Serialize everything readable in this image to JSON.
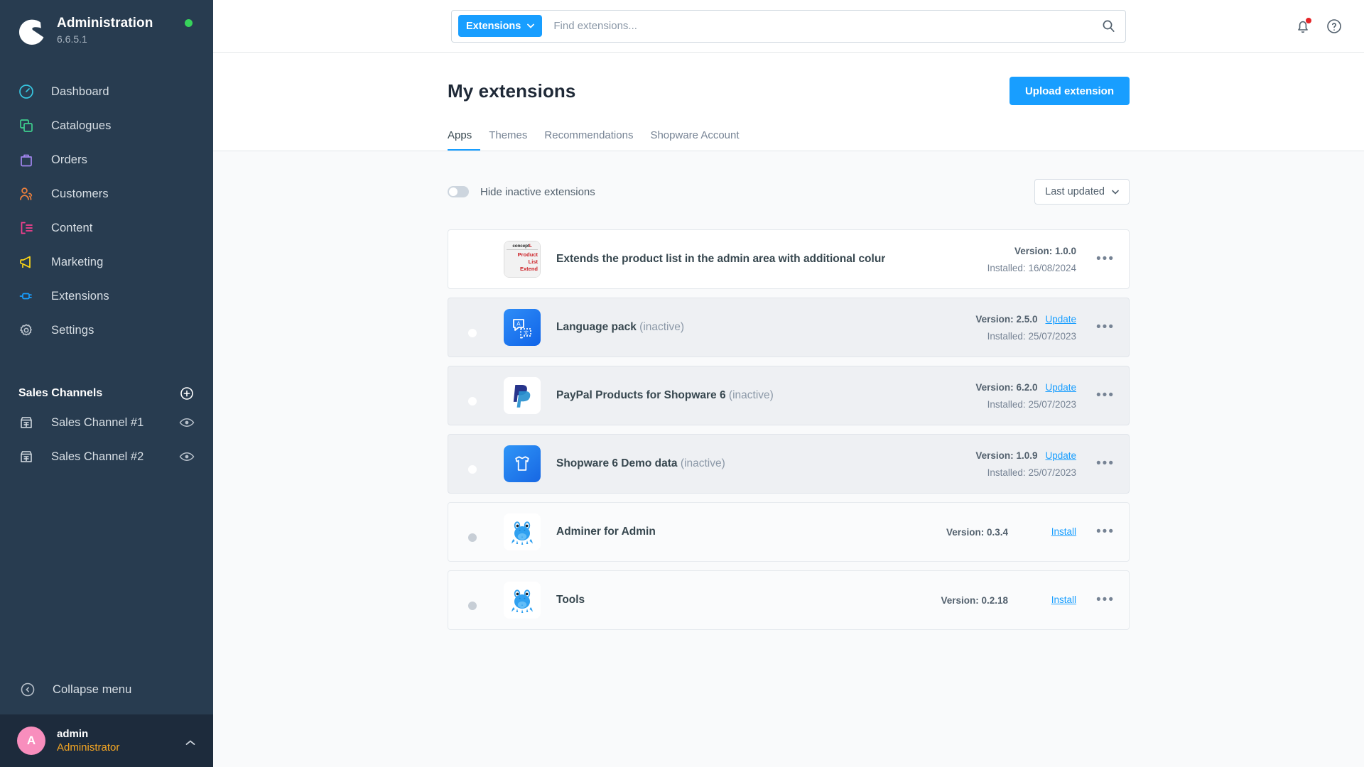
{
  "sidebar": {
    "title": "Administration",
    "version": "6.6.5.1",
    "status_color": "#37d35b",
    "nav": [
      {
        "label": "Dashboard",
        "icon": "gauge-icon",
        "color": "#37c6e0"
      },
      {
        "label": "Catalogues",
        "icon": "copy-icon",
        "color": "#3ecf8e"
      },
      {
        "label": "Orders",
        "icon": "bag-icon",
        "color": "#a386f0"
      },
      {
        "label": "Customers",
        "icon": "users-icon",
        "color": "#f0813c"
      },
      {
        "label": "Content",
        "icon": "content-icon",
        "color": "#f53f8e"
      },
      {
        "label": "Marketing",
        "icon": "megaphone-icon",
        "color": "#ffd814"
      },
      {
        "label": "Extensions",
        "icon": "plug-icon",
        "color": "#189eff"
      },
      {
        "label": "Settings",
        "icon": "gear-icon",
        "color": "#b6bfc9"
      }
    ],
    "section_title": "Sales Channels",
    "channels": [
      {
        "label": "Sales Channel #1"
      },
      {
        "label": "Sales Channel #2"
      }
    ],
    "collapse_label": "Collapse menu",
    "user": {
      "initial": "A",
      "name": "admin",
      "role": "Administrator",
      "role_color": "#f5a623"
    }
  },
  "topbar": {
    "scope_label": "Extensions",
    "search_placeholder": "Find extensions...",
    "notifications_badge": true
  },
  "page": {
    "title": "My extensions",
    "upload_label": "Upload extension",
    "tabs": [
      {
        "label": "Apps",
        "active": true
      },
      {
        "label": "Themes",
        "active": false
      },
      {
        "label": "Recommendations",
        "active": false
      },
      {
        "label": "Shopware Account",
        "active": false
      }
    ],
    "hide_inactive_label": "Hide inactive extensions",
    "hide_inactive_on": false,
    "sort_label": "Last updated",
    "version_prefix": "Version:",
    "installed_prefix": "Installed:"
  },
  "extensions": [
    {
      "name": "Extends the product list in the admin area with additional colur",
      "status_suffix": "",
      "state": "active",
      "enabled": true,
      "version": "1.0.0",
      "installed": "16/08/2024",
      "action": "",
      "logo": "concept-product-list-extend-logo"
    },
    {
      "name": "Language pack",
      "status_suffix": "(inactive)",
      "state": "inactive",
      "enabled": false,
      "version": "2.5.0",
      "installed": "25/07/2023",
      "action": "Update",
      "logo": "language-pack-logo"
    },
    {
      "name": "PayPal Products for Shopware 6",
      "status_suffix": "(inactive)",
      "state": "inactive",
      "enabled": false,
      "version": "6.2.0",
      "installed": "25/07/2023",
      "action": "Update",
      "logo": "paypal-logo"
    },
    {
      "name": "Shopware 6 Demo data",
      "status_suffix": "(inactive)",
      "state": "inactive",
      "enabled": false,
      "version": "1.0.9",
      "installed": "25/07/2023",
      "action": "Update",
      "logo": "tshirt-logo"
    },
    {
      "name": "Adminer for Admin",
      "status_suffix": "",
      "state": "not-installed",
      "enabled": false,
      "version": "0.3.4",
      "installed": "",
      "action": "Install",
      "logo": "frosh-frog-logo"
    },
    {
      "name": "Tools",
      "status_suffix": "",
      "state": "not-installed",
      "enabled": false,
      "version": "0.2.18",
      "installed": "",
      "action": "Install",
      "logo": "frosh-frog-logo"
    }
  ],
  "colors": {
    "accent": "#189eff",
    "sidebar_bg": "#283c50",
    "user_bg": "#1d2b3c"
  }
}
